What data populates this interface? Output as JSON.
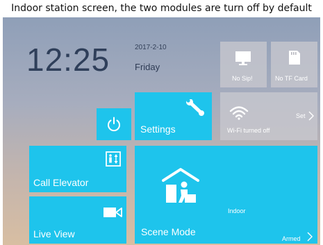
{
  "caption": "Indoor station screen, the two modules are turn off by default",
  "status": {
    "time": "12:25",
    "date": "2017-2-10",
    "weekday": "Friday"
  },
  "tiles": {
    "settings_label": "Settings",
    "no_sip_label": "No Sip!",
    "no_tf_card_label": "No TF Card",
    "wifi_status": "Wi-Fi turned off",
    "wifi_set_label": "Set",
    "call_elevator_label": "Call Elevator",
    "live_view_label": "Live View",
    "scene_mode_label": "Scene Mode",
    "scene_location": "Indoor",
    "scene_status": "Armed"
  },
  "colors": {
    "tile_blue": "#1ec4ec",
    "tile_grey": "#c8c8ce",
    "clock_text": "#2f3f5a"
  },
  "icons": {
    "power": "power-icon",
    "settings": "wrench-icon",
    "sip": "monitor-icon",
    "tf_card": "sd-card-icon",
    "wifi": "wifi-icon",
    "elevator": "elevator-icon",
    "live_view": "video-camera-icon",
    "scene": "home-person-icon"
  }
}
